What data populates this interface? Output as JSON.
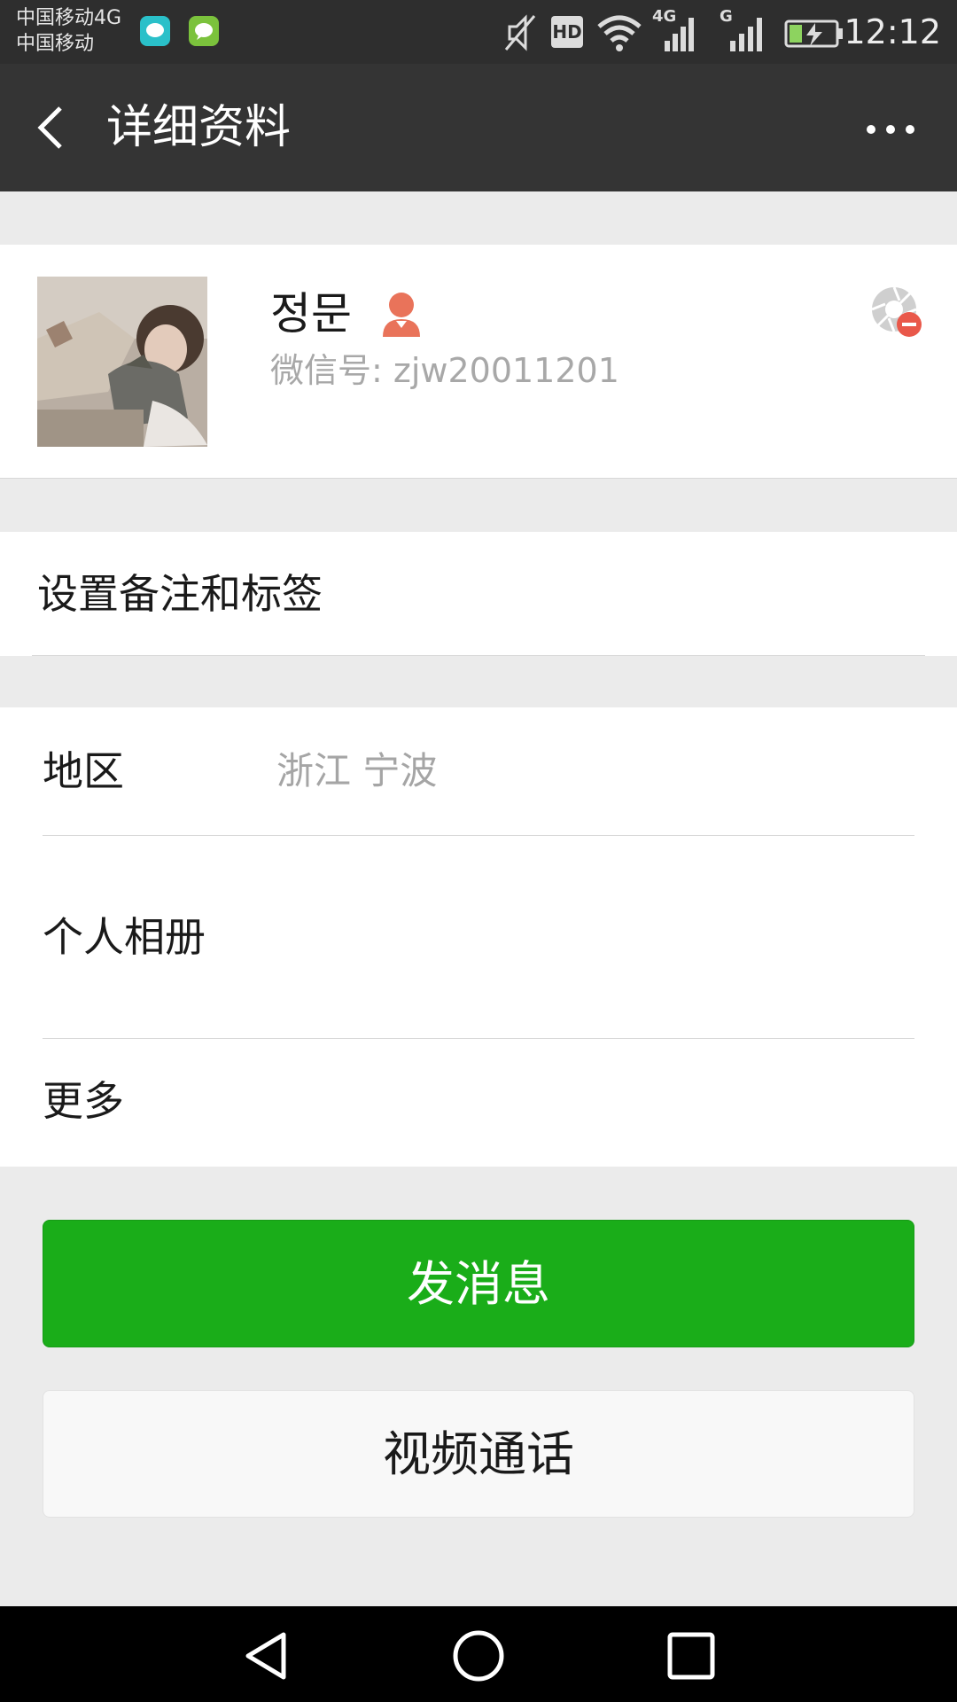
{
  "status_bar": {
    "carrier_line1": "中国移动4G",
    "carrier_line2": "中国移动",
    "hd_label": "HD",
    "net_4g": "4G",
    "net_g": "G",
    "time": "12:12"
  },
  "title_bar": {
    "title": "详细资料"
  },
  "profile": {
    "nickname": "정문",
    "wechat_id": "微信号: zjw20011201",
    "gender": "female"
  },
  "remark": {
    "label": "设置备注和标签"
  },
  "info": {
    "region_label": "地区",
    "region_value": "浙江  宁波",
    "album_label": "个人相册",
    "more_label": "更多"
  },
  "actions": {
    "send_message": "发消息",
    "video_call": "视频通话"
  },
  "colors": {
    "primary_green": "#1aad19",
    "title_bar": "#343434",
    "gender_icon": "#e9735a"
  }
}
